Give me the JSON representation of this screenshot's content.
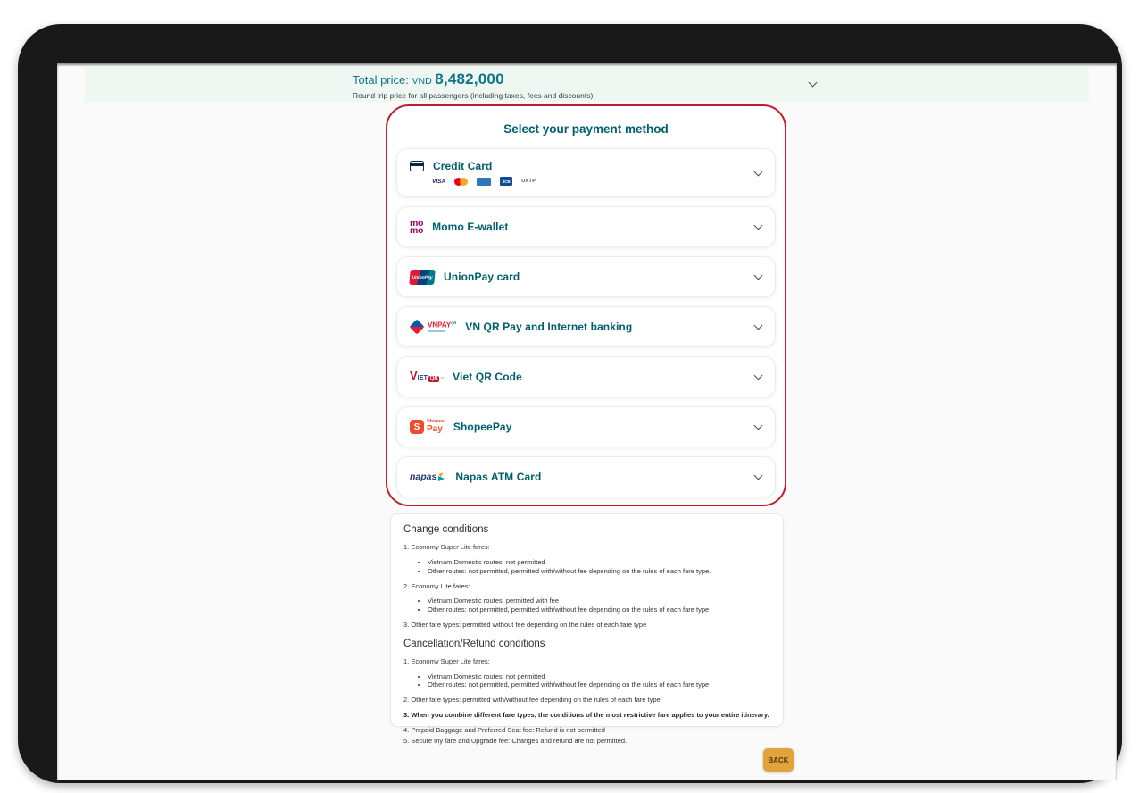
{
  "price_bar": {
    "label": "Total price:",
    "currency": "VND",
    "amount": "8,482,000",
    "subtext": "Round trip price for all passengers (including taxes, fees and discounts)."
  },
  "payment": {
    "title": "Select your payment method",
    "methods": [
      {
        "label": "Credit Card"
      },
      {
        "label": "Momo E-wallet"
      },
      {
        "label": "UnionPay card"
      },
      {
        "label": "VN QR Pay and Internet banking"
      },
      {
        "label": "Viet QR Code"
      },
      {
        "label": "ShopeePay"
      },
      {
        "label": "Napas ATM Card"
      }
    ],
    "card_logos": {
      "visa": "VISA",
      "jcb": "JCB",
      "uatp": "UATP"
    },
    "logo_text": {
      "momo1": "mo",
      "momo2": "mo",
      "unionpay": "UnionPay",
      "vnpay": "VNPAY",
      "vnpay_sup": "QR",
      "vietqr_v": "V",
      "vietqr_iet": "IET",
      "vietqr_qr": "QR",
      "vietqr_tm": "™",
      "shopee_badge": "S",
      "shopee_top": "Shopee",
      "shopee_bottom": "Pay",
      "napas": "napas"
    }
  },
  "conditions": {
    "change": {
      "title": "Change conditions",
      "lines": [
        {
          "text": "1. Economy Super Lite fares:"
        },
        {
          "items": [
            "Vietnam Domestic routes: not permitted",
            "Other routes: not permitted, permitted with/without fee depending on the rules of each fare type."
          ]
        },
        {
          "text": "2. Economy Lite fares:"
        },
        {
          "items": [
            "Vietnam Domestic routes: permitted with fee",
            "Other routes: not permitted, permitted with/without fee depending on the rules of each fare type"
          ]
        },
        {
          "text": "3. Other fare types: permitted without fee depending on the rules of each fare type"
        }
      ]
    },
    "refund": {
      "title": "Cancellation/Refund conditions",
      "lines": [
        {
          "text": "1. Economy Super Lite fares:"
        },
        {
          "items": [
            "Vietnam Domestic routes: not permitted",
            "Other routes: not permitted, permitted with/without fee depending on the rules of each fare type"
          ]
        },
        {
          "text": "2. Other fare types: permitted with/without fee depending on the rules of each fare type"
        },
        {
          "text": "3. When you combine different fare types, the conditions of the most restrictive fare applies to your entire itinerary."
        },
        {
          "text": "4. Prepaid Baggage and Preferred Seat fee: Refund is not permitted"
        },
        {
          "text": "5. Secure my fare and Upgrade fee: Changes and refund are not permitted."
        }
      ]
    }
  },
  "back": {
    "label": "BACK"
  },
  "colors": {
    "accent_teal": "#00606e",
    "container_border_red": "#bf1f2c",
    "price_bar_bg": "#eff7f2",
    "back_button_bg": "#e2a33b",
    "momo_pink": "#a50064",
    "shopee_orange": "#ee4d2d"
  }
}
